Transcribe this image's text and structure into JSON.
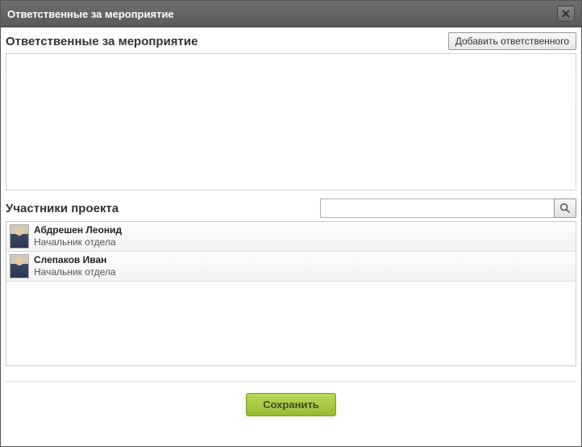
{
  "dialog": {
    "title": "Ответственные за мероприятие"
  },
  "responsible": {
    "heading": "Ответственные за мероприятие",
    "add_label": "Добавить ответственного"
  },
  "participants": {
    "heading": "Участники проекта",
    "search_placeholder": "",
    "items": [
      {
        "name": "Абдрешен Леонид",
        "role": "Начальник отдела"
      },
      {
        "name": "Слепаков Иван",
        "role": "Начальник отдела"
      }
    ]
  },
  "footer": {
    "save_label": "Сохранить"
  }
}
